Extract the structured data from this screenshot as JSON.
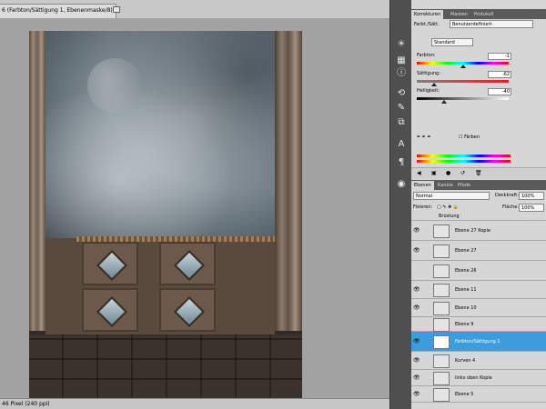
{
  "document": {
    "tab_title": "6 (Farbton/Sättigung 1, Ebenenmaske/8) *",
    "status_text": "46 Pixel (240 ppi)"
  },
  "adjustments": {
    "tabs": [
      "Korrekturen",
      "Masken",
      "Protokoll"
    ],
    "panel_title": "Farbt./Sätt.",
    "preset": "Benutzerdefiniert",
    "channel": "Standard",
    "hue_label": "Farbton:",
    "hue_value": "-1",
    "hue_level": 0.5,
    "saturation_label": "Sättigung:",
    "saturation_value": "-62",
    "saturation_level": 0.19,
    "lightness_label": "Helligkeit:",
    "lightness_value": "-40",
    "lightness_level": 0.3,
    "colorize_label": "Färben"
  },
  "layers_panel": {
    "tabs": [
      "Ebenen",
      "Kanäle",
      "Pfade"
    ],
    "blend_mode": "Normal",
    "opacity_label": "Deckkraft:",
    "opacity_value": "100%",
    "lock_label": "Fixieren:",
    "fill_label": "Fläche:",
    "fill_value": "100%",
    "group_label": "Brüstung",
    "layers": [
      {
        "name": "Ebene 27 Kopie",
        "visible": true,
        "selected": false
      },
      {
        "name": "Ebene 27",
        "visible": true,
        "selected": false
      },
      {
        "name": "Ebene 26",
        "visible": false,
        "selected": false
      },
      {
        "name": "Ebene 11",
        "visible": true,
        "selected": false
      },
      {
        "name": "Ebene 10",
        "visible": true,
        "selected": false
      },
      {
        "name": "Ebene 9",
        "visible": false,
        "selected": false
      },
      {
        "name": "Farbton/Sättigung 1",
        "visible": true,
        "selected": true
      },
      {
        "name": "Kurven 4",
        "visible": true,
        "selected": false
      },
      {
        "name": "links oben Kopie",
        "visible": true,
        "selected": false
      },
      {
        "name": "Ebene 5",
        "visible": true,
        "selected": false
      }
    ]
  },
  "colors": {
    "selection": "#3d9cdb",
    "panel_bg": "#d6d6d6",
    "dark_tab": "#5a5a5a"
  }
}
